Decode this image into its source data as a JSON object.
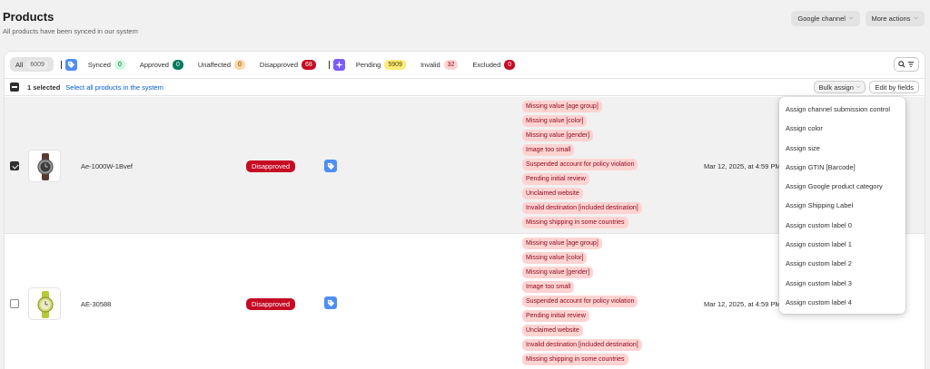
{
  "header": {
    "title": "Products",
    "subtitle": "All products have been synced in our system",
    "channel_button": "Google channel",
    "more_button": "More actions"
  },
  "tabs": [
    {
      "label": "All",
      "count": "6009",
      "bg": "#ebebeb",
      "fg": "#616161"
    },
    {
      "label": "Synced",
      "count": "0",
      "bg": "#cdfee1",
      "fg": "#0c5132"
    },
    {
      "label": "Approved",
      "count": "0",
      "bg": "#047b5d",
      "fg": "#ffffff"
    },
    {
      "label": "Unaffected",
      "count": "0",
      "bg": "#ffd6a4",
      "fg": "#5e4200"
    },
    {
      "label": "Disapproved",
      "count": "68",
      "bg": "#c70a24",
      "fg": "#ffffff"
    },
    {
      "label": "Pending",
      "count": "5909",
      "bg": "#ffeb78",
      "fg": "#4f4700"
    },
    {
      "label": "Invalid",
      "count": "32",
      "bg": "#fed3d1",
      "fg": "#8e0b21"
    },
    {
      "label": "Excluded",
      "count": "0",
      "bg": "#c70a24",
      "fg": "#ffffff"
    }
  ],
  "icons": {
    "google_tag": "tag-icon",
    "sparkle": "sparkle-icon",
    "search": "search-icon",
    "filter": "filter-icon"
  },
  "colors": {
    "google_blue": "#4f8ef7",
    "sparkle_purple": "#7c5cff",
    "disapproved": "#c70a24",
    "link": "#005bd3"
  },
  "bulk": {
    "selected_text": "1 selected",
    "select_all": "Select all products in the system",
    "bulk_assign": "Bulk assign",
    "edit_by_fields": "Edit by fields"
  },
  "rows": [
    {
      "checked": true,
      "sku": "Ae-1000W-1Bvef",
      "status": "Disapproved",
      "issues": [
        "Missing value [age group]",
        "Missing value [color]",
        "Missing value [gender]",
        "Image too small",
        "Suspended account for policy violation",
        "Pending initial review",
        "Unclaimed website",
        "Invalid destination [included destination]",
        "Missing shipping in some countries"
      ],
      "date": "Mar 12, 2025, at 4:59 PM"
    },
    {
      "checked": false,
      "sku": "AE-30588",
      "status": "Disapproved",
      "issues": [
        "Missing value [age group]",
        "Missing value [color]",
        "Missing value [gender]",
        "Image too small",
        "Suspended account for policy violation",
        "Pending initial review",
        "Unclaimed website",
        "Invalid destination [included destination]",
        "Missing shipping in some countries"
      ],
      "date": "Mar 12, 2025, at 4:59 PM"
    }
  ],
  "bulk_menu": [
    "Assign channel submission control",
    "Assign color",
    "Assign size",
    "Assign GTIN [Barcode]",
    "Assign Google product category",
    "Assign Shipping Label",
    "Assign custom label 0",
    "Assign custom label 1",
    "Assign custom label 2",
    "Assign custom label 3",
    "Assign custom label 4"
  ]
}
